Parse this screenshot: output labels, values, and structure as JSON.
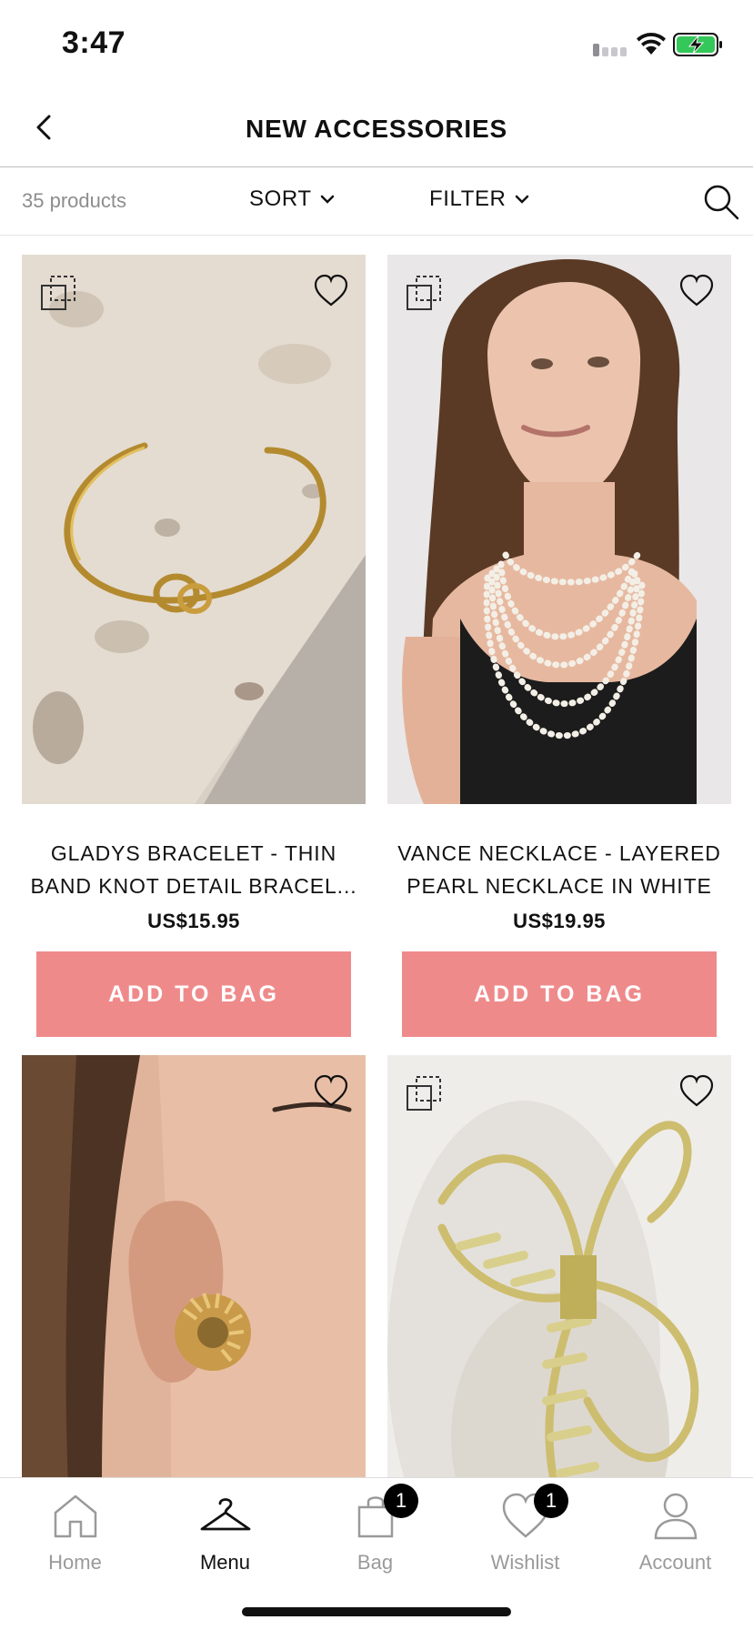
{
  "status_bar": {
    "time": "3:47"
  },
  "header": {
    "title": "NEW ACCESSORIES",
    "back_icon": "chevron-left-icon"
  },
  "toolbar": {
    "product_count": "35 products",
    "sort_label": "SORT",
    "filter_label": "FILTER",
    "search_icon": "search-icon"
  },
  "colors": {
    "add_to_bag_bg": "#ef8a8b",
    "badge_bg": "#000000",
    "active_nav": "#111111",
    "inactive_nav": "#9a9a9a"
  },
  "products": [
    {
      "name": "GLADYS BRACELET - THIN BAND KNOT DETAIL BRACEL...",
      "price": "US$15.95",
      "cta": "ADD TO BAG",
      "image": "gold knot cuff bracelet on stone"
    },
    {
      "name": "VANCE NECKLACE - LAYERED PEARL NECKLACE IN WHITE",
      "price": "US$19.95",
      "cta": "ADD TO BAG",
      "image": "model wearing layered pearl necklace"
    },
    {
      "name": "",
      "price": "",
      "cta": "",
      "image": "gold twisted hoop earring on model"
    },
    {
      "name": "",
      "price": "",
      "cta": "",
      "image": "gold claw hair clip"
    }
  ],
  "bottom_nav": {
    "items": [
      {
        "label": "Home",
        "icon": "home-icon",
        "active": false
      },
      {
        "label": "Menu",
        "icon": "hanger-icon",
        "active": true
      },
      {
        "label": "Bag",
        "icon": "shopping-bag-icon",
        "active": false,
        "badge": "1"
      },
      {
        "label": "Wishlist",
        "icon": "heart-icon",
        "active": false,
        "badge": "1"
      },
      {
        "label": "Account",
        "icon": "user-icon",
        "active": false
      }
    ]
  }
}
